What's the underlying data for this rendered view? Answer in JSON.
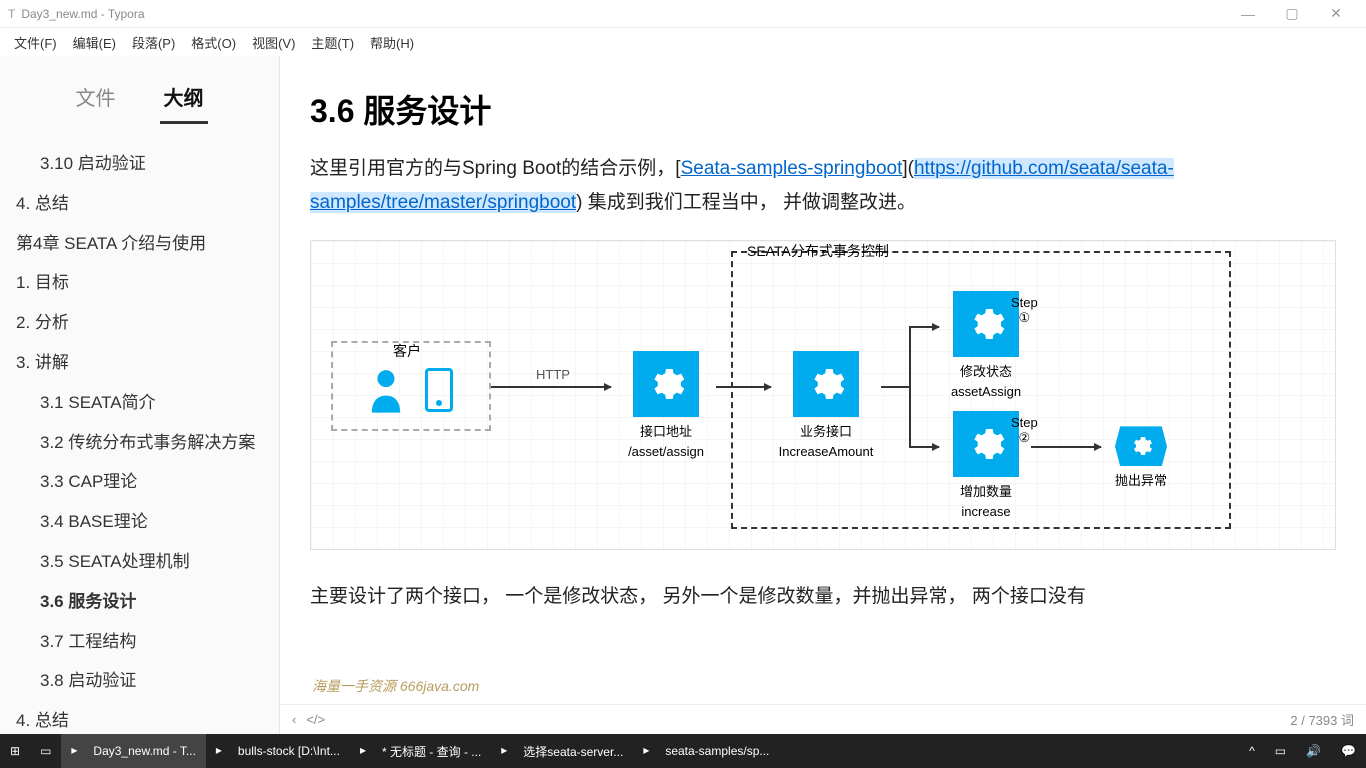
{
  "window": {
    "title": "Day3_new.md - Typora",
    "min": "—",
    "max": "▢",
    "close": "✕"
  },
  "menu": [
    "文件(F)",
    "编辑(E)",
    "段落(P)",
    "格式(O)",
    "视图(V)",
    "主题(T)",
    "帮助(H)"
  ],
  "sidebar": {
    "tabs": {
      "file": "文件",
      "outline": "大纲"
    },
    "items": [
      {
        "text": "3.10 启动验证",
        "lvl": "l2"
      },
      {
        "text": "4. 总结",
        "lvl": "l1"
      },
      {
        "text": "第4章 SEATA 介绍与使用",
        "lvl": "l1"
      },
      {
        "text": "1. 目标",
        "lvl": "l1"
      },
      {
        "text": "2. 分析",
        "lvl": "l1"
      },
      {
        "text": "3. 讲解",
        "lvl": "l1"
      },
      {
        "text": "3.1 SEATA简介",
        "lvl": "l2"
      },
      {
        "text": "3.2 传统分布式事务解决方案",
        "lvl": "l2"
      },
      {
        "text": "3.3 CAP理论",
        "lvl": "l2"
      },
      {
        "text": "3.4 BASE理论",
        "lvl": "l2"
      },
      {
        "text": "3.5 SEATA处理机制",
        "lvl": "l2"
      },
      {
        "text": "3.6 服务设计",
        "lvl": "l2",
        "active": true
      },
      {
        "text": "3.7 工程结构",
        "lvl": "l2"
      },
      {
        "text": "3.8 启动验证",
        "lvl": "l2"
      },
      {
        "text": "4. 总结",
        "lvl": "l1"
      }
    ]
  },
  "content": {
    "heading": "3.6 服务设计",
    "para1_a": "这里引用官方的与Spring Boot的结合示例，[",
    "link1": "Seata-samples-springboot",
    "para1_b": "](",
    "link2": "https://github.com/seata/seata-samples/tree/master/springboot",
    "para1_c": ") 集成到我们工程当中， 并做调整改进。",
    "para2": "主要设计了两个接口， 一个是修改状态， 另外一个是修改数量，并抛出异常， 两个接口没有"
  },
  "diagram": {
    "seata_title": "SEATA分布式事务控制",
    "client": "客户",
    "http": "HTTP",
    "endpoint_t": "接口地址",
    "endpoint_b": "/asset/assign",
    "biz_t": "业务接口",
    "biz_b": "IncreaseAmount",
    "step1": "Step ①",
    "mod1_t": "修改状态",
    "mod1_b": "assetAssign",
    "step2": "Step ②",
    "mod2_t": "增加数量",
    "mod2_b": "increase",
    "throw": "抛出异常"
  },
  "status": {
    "back": "‹",
    "code": "</>",
    "count": "2 / 7393 词"
  },
  "watermark": "海量一手资源 666java.com",
  "taskbar": {
    "items": [
      {
        "label": "Day3_new.md - T...",
        "active": true
      },
      {
        "label": "bulls-stock [D:\\Int..."
      },
      {
        "label": "* 无标题 - 查询 - ..."
      },
      {
        "label": "选择seata-server..."
      },
      {
        "label": "seata-samples/sp..."
      }
    ]
  }
}
